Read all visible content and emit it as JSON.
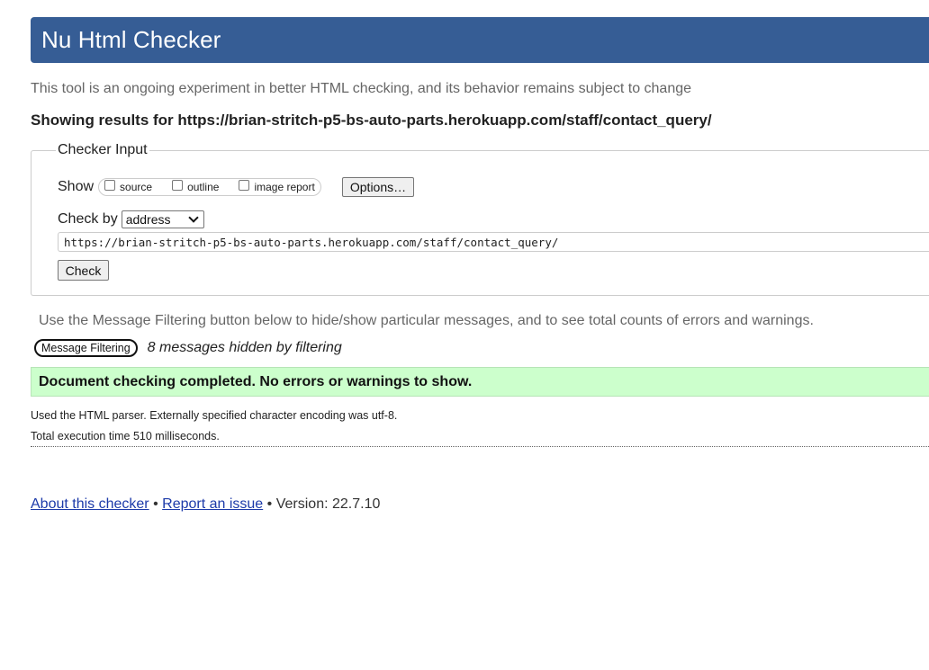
{
  "header": {
    "title": "Nu Html Checker"
  },
  "subtitle": "This tool is an ongoing experiment in better HTML checking, and its behavior remains subject to change",
  "results_for": "Showing results for https://brian-stritch-p5-bs-auto-parts.herokuapp.com/staff/contact_query/",
  "checker_input": {
    "legend": "Checker Input",
    "show_label": "Show",
    "show_options": [
      {
        "label": "source",
        "checked": false
      },
      {
        "label": "outline",
        "checked": false
      },
      {
        "label": "image report",
        "checked": false
      }
    ],
    "options_button": "Options…",
    "check_by_label": "Check by",
    "check_by_value": "address",
    "url_value": "https://brian-stritch-p5-bs-auto-parts.herokuapp.com/staff/contact_query/",
    "check_button": "Check"
  },
  "filtering": {
    "note": "Use the Message Filtering button below to hide/show particular messages, and to see total counts of errors and warnings.",
    "button": "Message Filtering",
    "hidden_count": "8 messages hidden by filtering"
  },
  "result": {
    "message": "Document checking completed. No errors or warnings to show.",
    "color": "#ccffcc"
  },
  "details": {
    "parser": "Used the HTML parser. Externally specified character encoding was utf-8.",
    "execution_time": "Total execution time 510 milliseconds."
  },
  "footer": {
    "about_link": "About this checker",
    "separator": "•",
    "report_link": "Report an issue",
    "version": "Version: 22.7.10"
  },
  "colors": {
    "header_bg": "#365d95",
    "link": "#1c3aa9"
  }
}
